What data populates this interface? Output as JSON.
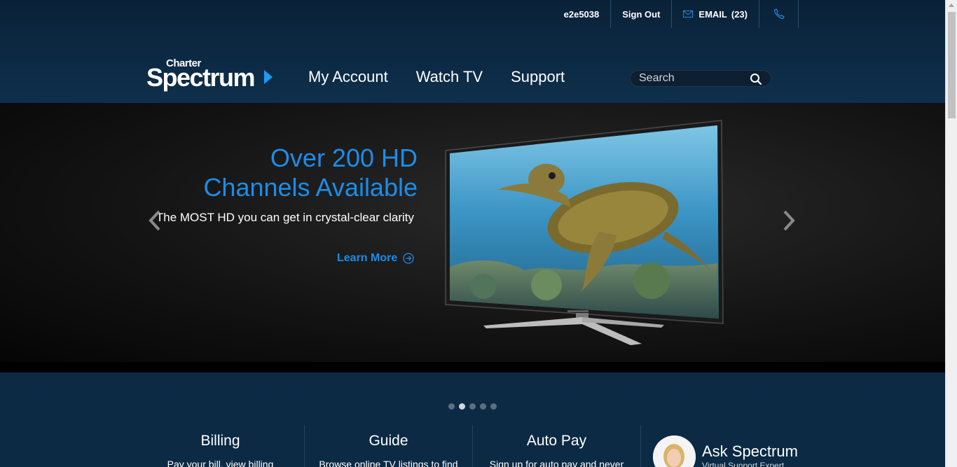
{
  "utility": {
    "username": "e2e5038",
    "sign_out": "Sign Out",
    "email_label": "EMAIL",
    "email_count": "(23)"
  },
  "logo": {
    "top": "Charter",
    "main": "Spectrum"
  },
  "nav": {
    "items": [
      {
        "label": "My Account"
      },
      {
        "label": "Watch TV"
      },
      {
        "label": "Support"
      }
    ]
  },
  "search": {
    "placeholder": "Search"
  },
  "hero": {
    "title_line1": "Over 200 HD",
    "title_line2": "Channels Available",
    "subtitle": "The MOST HD you can get in crystal-clear clarity",
    "cta": "Learn More",
    "slide_count": 5,
    "active_slide": 2
  },
  "cards": [
    {
      "title": "Billing",
      "text": "Pay your bill, view billing"
    },
    {
      "title": "Guide",
      "text": "Browse online TV listings to find"
    },
    {
      "title": "Auto Pay",
      "text": "Sign up for auto pay and never"
    }
  ],
  "ask": {
    "title": "Ask Spectrum",
    "subtitle": "Virtual Support Expert"
  },
  "colors": {
    "accent": "#1d8ce8",
    "header_bg": "#0e2f4c",
    "hero_bg": "#141414"
  }
}
